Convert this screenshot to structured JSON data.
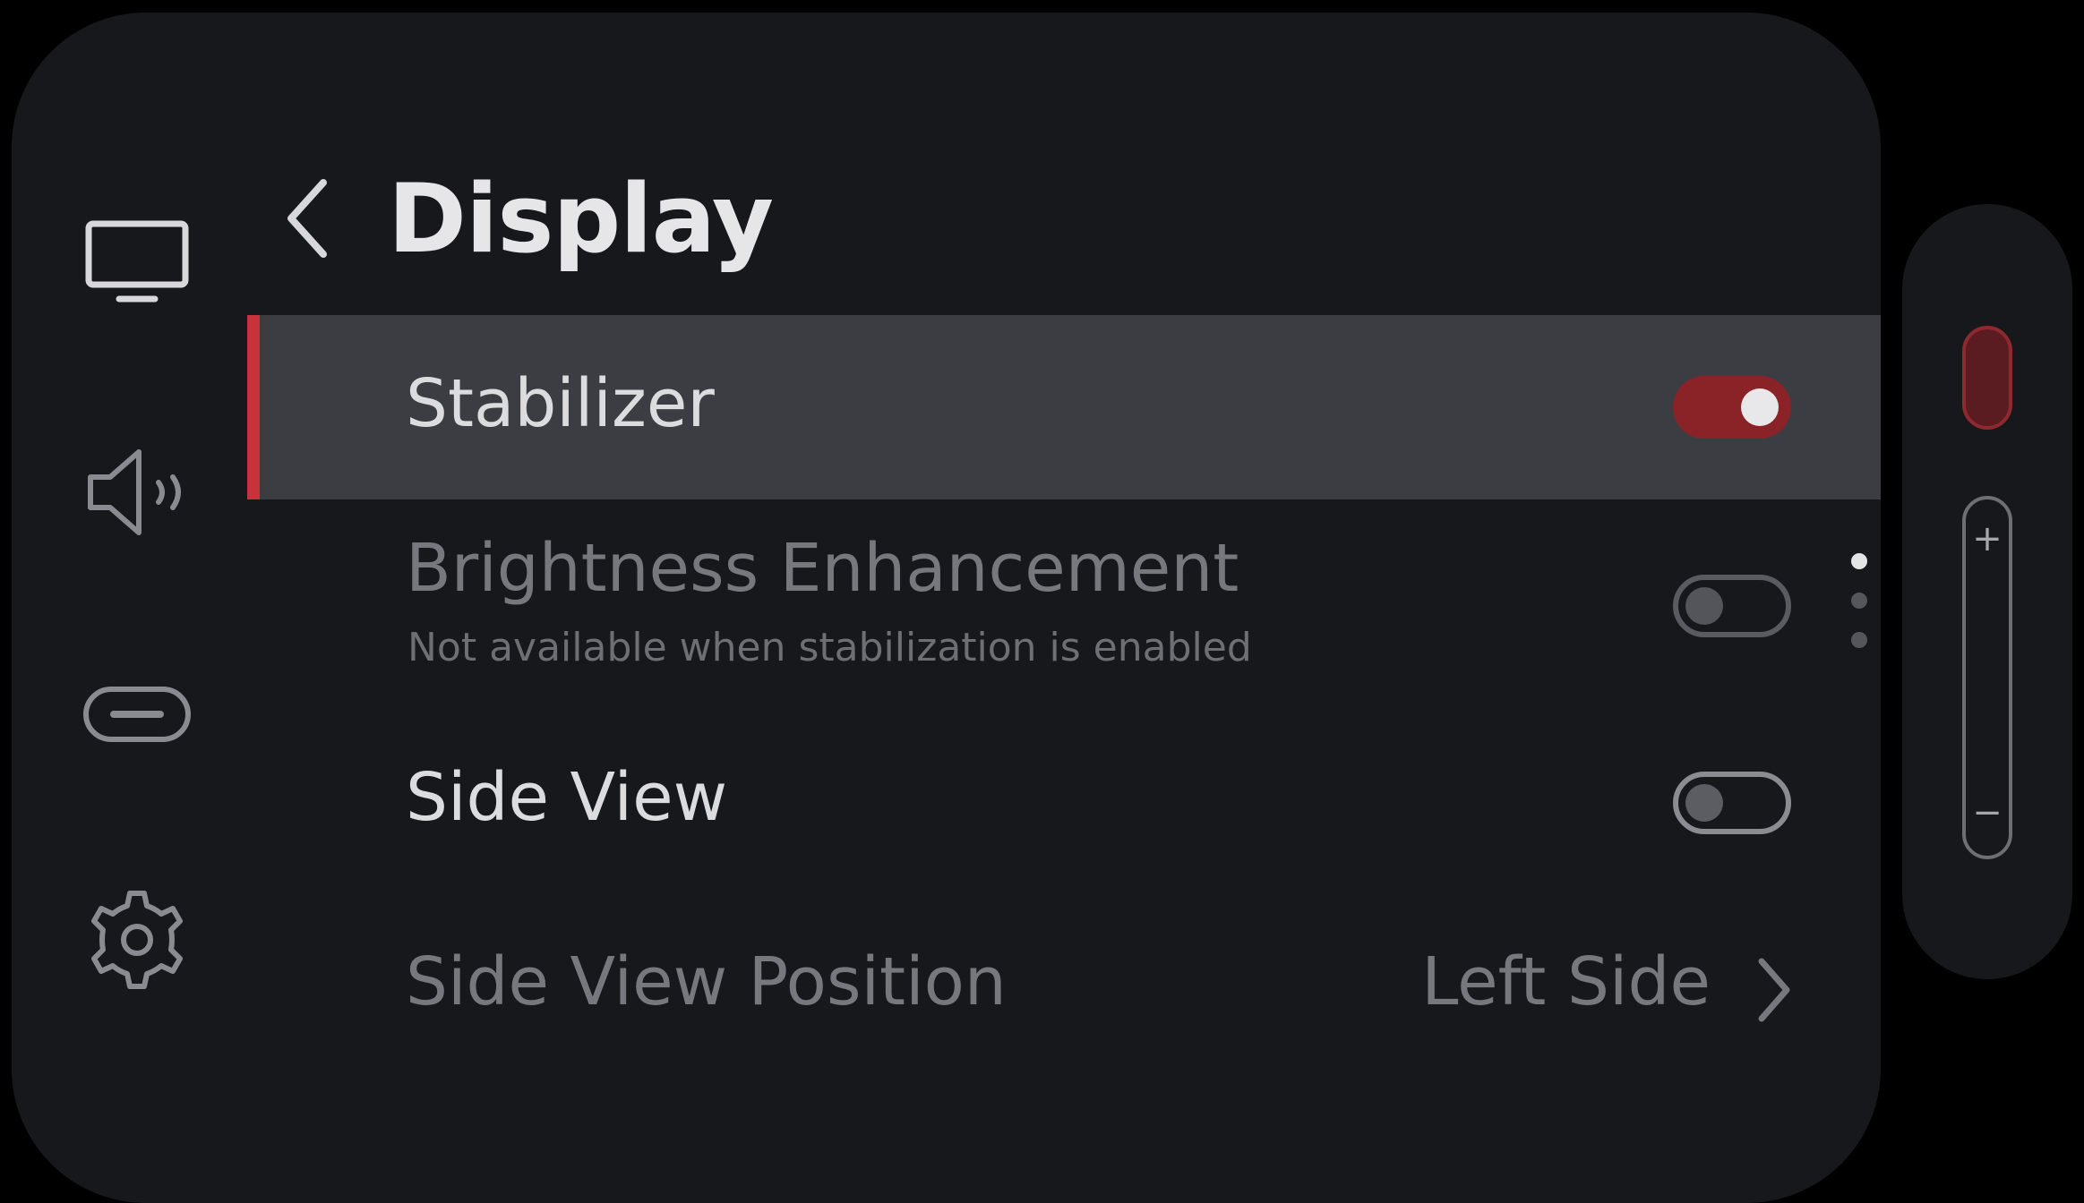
{
  "nav": {
    "items": [
      {
        "icon": "display-icon",
        "active": true
      },
      {
        "icon": "speaker-icon",
        "active": false
      },
      {
        "icon": "button-icon",
        "active": false
      },
      {
        "icon": "gear-icon",
        "active": false
      }
    ]
  },
  "header": {
    "back_icon": "chevron-left-icon",
    "title": "Display"
  },
  "settings": {
    "stabilizer": {
      "label": "Stabilizer",
      "state": "on"
    },
    "brightness": {
      "label": "Brightness Enhancement",
      "sub": "Not available when stabilization is enabled",
      "state": "off",
      "enabled": false
    },
    "side_view": {
      "label": "Side View",
      "state": "off"
    },
    "side_view_position": {
      "label": "Side View Position",
      "value": "Left Side",
      "enabled": false
    }
  },
  "pagination": {
    "pages": 3,
    "current": 1
  },
  "side_controls": {
    "record_icon": "record-button",
    "zoom_plus": "+",
    "zoom_minus": "−"
  },
  "colors": {
    "accent": "#c8323a",
    "toggle_on": "#8a2328",
    "panel_bg": "#17181c",
    "selected_row_bg": "#3c3d42"
  }
}
